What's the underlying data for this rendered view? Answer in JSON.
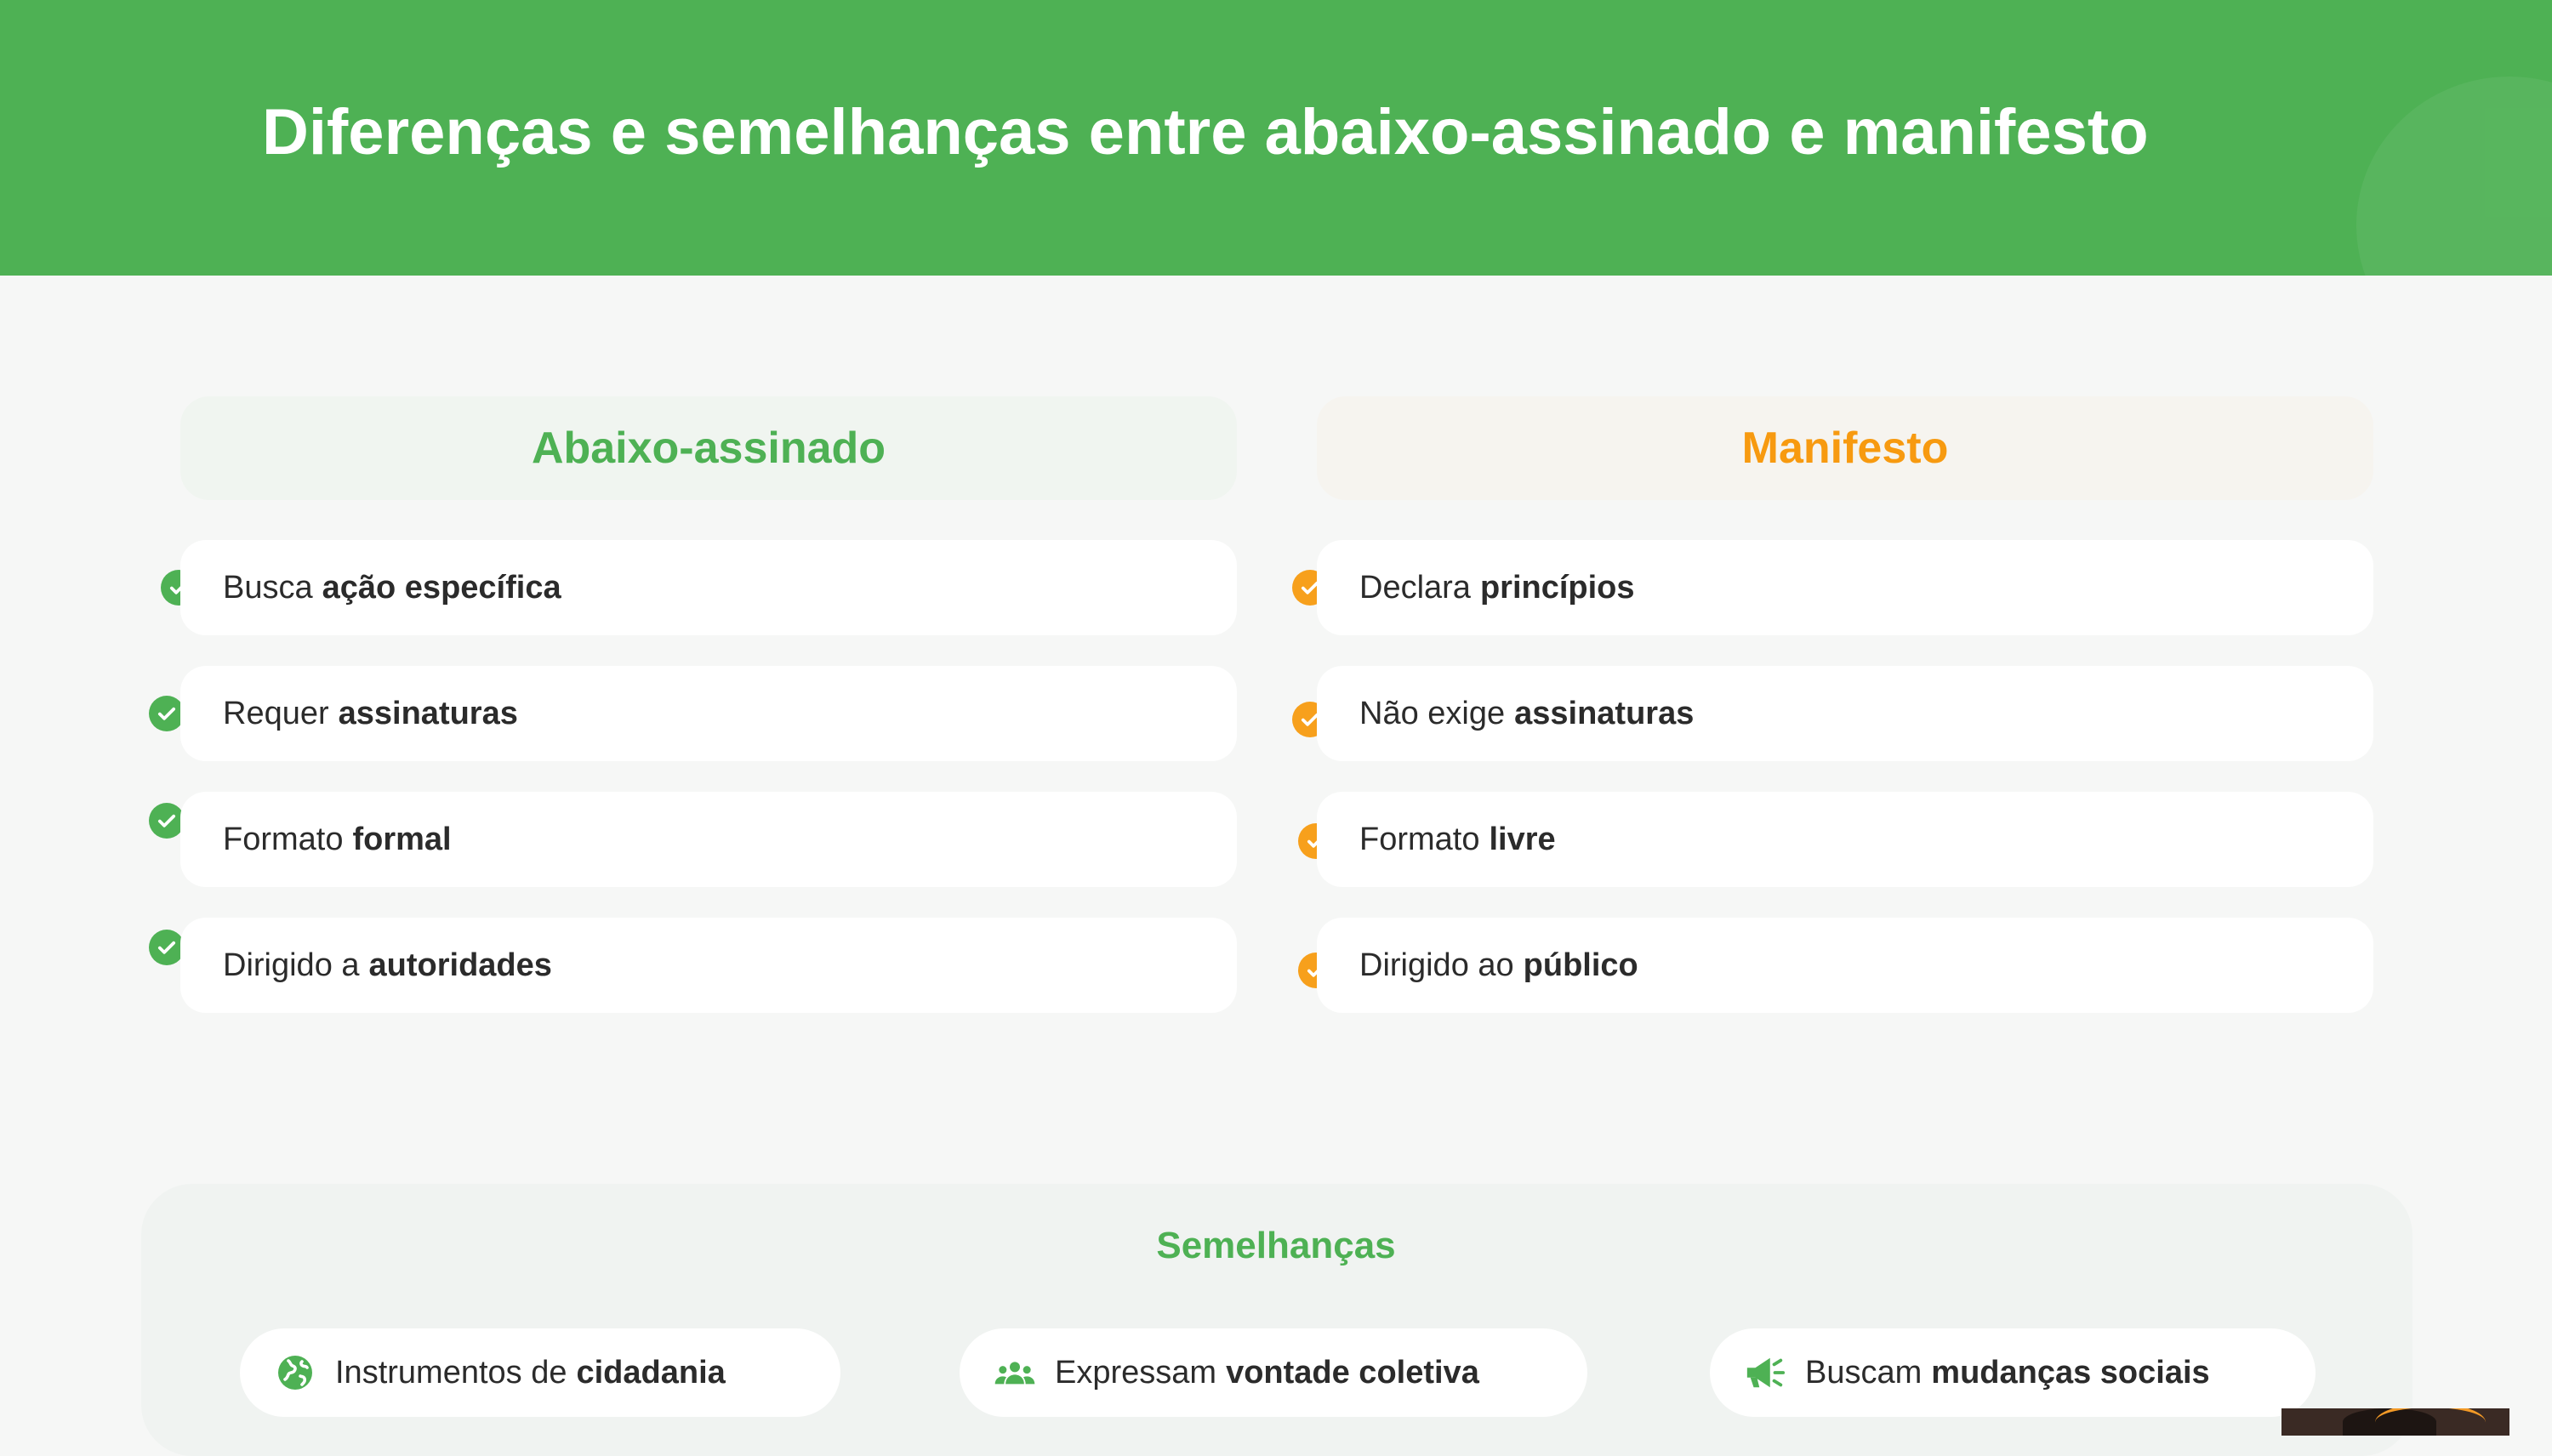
{
  "header": {
    "title": "Diferenças e semelhanças entre abaixo-assinado e manifesto",
    "color": "#4eb154"
  },
  "columns": {
    "left": {
      "title": "Abaixo-assinado",
      "accent": "#4eb154",
      "items": [
        {
          "text": "Busca",
          "bold": "ação específica"
        },
        {
          "text": "Requer",
          "bold": "assinaturas"
        },
        {
          "text": "Formato",
          "bold": "formal"
        },
        {
          "text": "Dirigido a",
          "bold": "autoridades"
        }
      ]
    },
    "right": {
      "title": "Manifesto",
      "accent": "#f79a10",
      "items": [
        {
          "text": "Declara",
          "bold": "princípios"
        },
        {
          "text": "Não exige",
          "bold": "assinaturas"
        },
        {
          "text": "Formato",
          "bold": "livre"
        },
        {
          "text": "Dirigido ao",
          "bold": "público"
        }
      ]
    }
  },
  "similarities": {
    "title": "Semelhanças",
    "items": [
      {
        "icon": "globe-icon",
        "text": "Instrumentos de",
        "bold": "cidadania"
      },
      {
        "icon": "users-icon",
        "text": "Expressam",
        "bold": "vontade coletiva"
      },
      {
        "icon": "megaphone-icon",
        "text": "Buscam",
        "bold": "mudanças sociais"
      }
    ]
  }
}
